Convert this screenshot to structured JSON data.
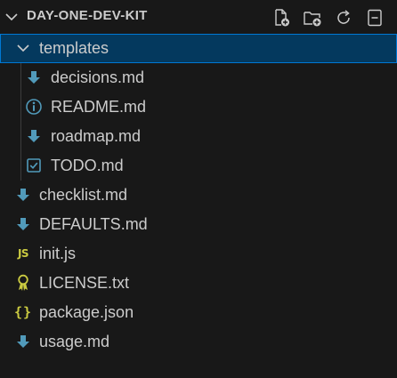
{
  "explorer": {
    "title": "DAY-ONE-DEV-KIT",
    "actions": [
      {
        "name": "new-file",
        "icon": "new-file-icon"
      },
      {
        "name": "new-folder",
        "icon": "new-folder-icon"
      },
      {
        "name": "refresh",
        "icon": "refresh-icon"
      },
      {
        "name": "collapse-all",
        "icon": "collapse-all-icon"
      }
    ]
  },
  "tree": {
    "folder": {
      "label": "templates",
      "icon": "chevron-down-icon",
      "expanded": true,
      "selected": true
    },
    "children": [
      {
        "label": "decisions.md",
        "icon": "markdown-icon"
      },
      {
        "label": "README.md",
        "icon": "info-icon"
      },
      {
        "label": "roadmap.md",
        "icon": "markdown-icon"
      },
      {
        "label": "TODO.md",
        "icon": "checkbox-icon"
      }
    ],
    "files": [
      {
        "label": "checklist.md",
        "icon": "markdown-icon"
      },
      {
        "label": "DEFAULTS.md",
        "icon": "markdown-icon"
      },
      {
        "label": "init.js",
        "icon": "javascript-icon",
        "glyph": "JS"
      },
      {
        "label": "LICENSE.txt",
        "icon": "license-icon"
      },
      {
        "label": "package.json",
        "icon": "json-icon",
        "glyph": "{}"
      },
      {
        "label": "usage.md",
        "icon": "markdown-icon"
      }
    ]
  },
  "colors": {
    "background": "#181818",
    "selected_background": "#04395e",
    "selected_border": "#0078d4",
    "markdown_icon": "#519aba",
    "js_icon": "#cbcb41",
    "license_icon": "#cbcb41",
    "text": "#cccccc"
  }
}
